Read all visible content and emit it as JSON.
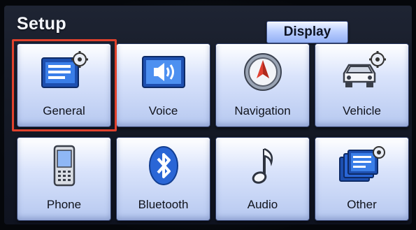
{
  "header": {
    "title": "Setup",
    "display_button_label": "Display"
  },
  "tiles": [
    {
      "label": "General",
      "icon": "general-settings-icon",
      "selected": true
    },
    {
      "label": "Voice",
      "icon": "speaker-icon",
      "selected": false
    },
    {
      "label": "Navigation",
      "icon": "compass-icon",
      "selected": false
    },
    {
      "label": "Vehicle",
      "icon": "car-gear-icon",
      "selected": false
    },
    {
      "label": "Phone",
      "icon": "mobile-phone-icon",
      "selected": false
    },
    {
      "label": "Bluetooth",
      "icon": "bluetooth-icon",
      "selected": false
    },
    {
      "label": "Audio",
      "icon": "music-note-icon",
      "selected": false
    },
    {
      "label": "Other",
      "icon": "other-settings-icon",
      "selected": false
    }
  ],
  "colors": {
    "selection_highlight": "#e0412c",
    "tile_blue": "#b6c8f0",
    "icon_blue": "#2a66d6"
  }
}
